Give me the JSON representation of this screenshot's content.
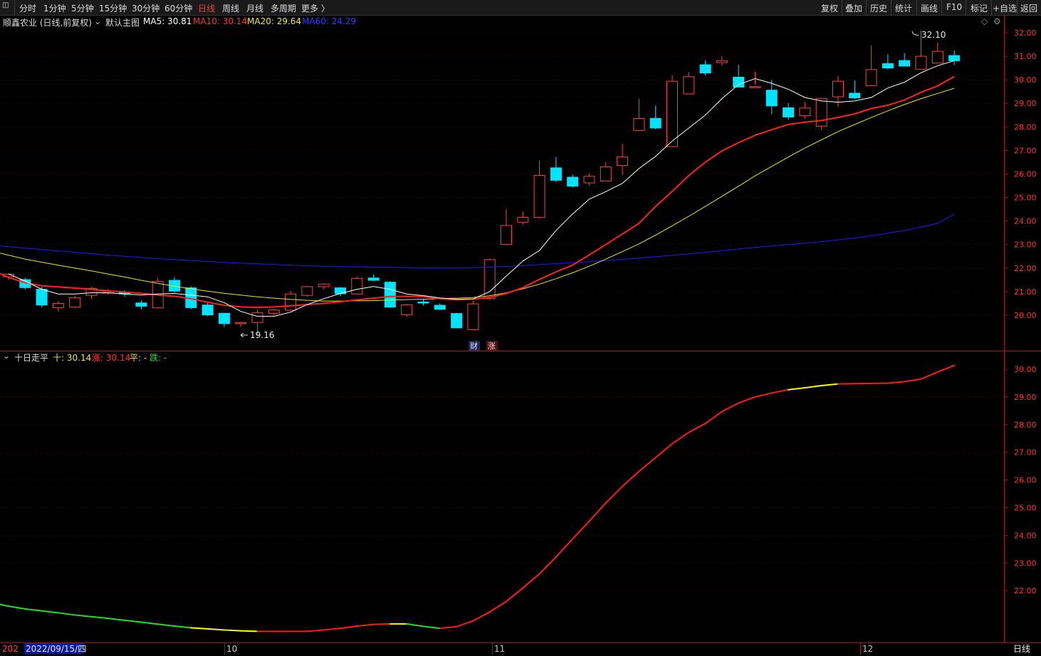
{
  "toolbar": {
    "periods": [
      "分时",
      "1分钟",
      "5分钟",
      "15分钟",
      "30分钟",
      "60分钟",
      "日线",
      "周线",
      "月线",
      "多周期",
      "更多 〉"
    ],
    "active_period": "日线",
    "right_items": [
      "复权",
      "叠加",
      "历史",
      "统计",
      "画线",
      "F10",
      "标记",
      "+自选",
      "返回"
    ]
  },
  "main": {
    "stock_label": "顺鑫农业 (日线,前复权)",
    "template_label": "默认主图",
    "ma5": "MA5: 30.81",
    "ma10": "MA10: 30.14",
    "ma20": "MA20: 29.64",
    "ma60": "MA60: 24.29",
    "high_label": "32.10",
    "low_label": "19.16",
    "tag_cai": "财",
    "tag_zhang": "涨",
    "price_ticks": [
      "32.00",
      "31.00",
      "30.00",
      "29.00",
      "28.00",
      "27.00",
      "26.00",
      "25.00",
      "24.00",
      "23.00",
      "22.00",
      "21.00",
      "20.00"
    ]
  },
  "indicator": {
    "name": "十日走平",
    "ten": "十: 30.14",
    "up": "涨: 30.14",
    "flat": "平: -",
    "down": "跌: -",
    "ticks": [
      "30.00",
      "29.00",
      "28.00",
      "27.00",
      "26.00",
      "25.00",
      "24.00",
      "23.00",
      "22.00"
    ]
  },
  "date_axis": {
    "year_prefix": "202",
    "cursor_date": "2022/09/15/四",
    "month_labels": [
      "10",
      "11",
      "12"
    ],
    "period": "日线"
  },
  "colors": {
    "up": "#ff4040",
    "down": "#00e5ff",
    "ma5": "#ffffff",
    "ma10": "#ff2020",
    "ma20": "#e8e800",
    "ma60": "#1a1aff",
    "ind_up": "#ff1a1a",
    "ind_flat": "#ffff00",
    "ind_down": "#20e020"
  },
  "chart_data": [
    {
      "type": "candlestick",
      "title": "顺鑫农业 (日线,前复权)",
      "ylim": [
        19.0,
        32.5
      ],
      "candles": [
        [
          21.63,
          21.74,
          21.5,
          21.78
        ],
        [
          21.51,
          21.17,
          21.1,
          21.59
        ],
        [
          21.1,
          20.43,
          20.34,
          21.2
        ],
        [
          20.32,
          20.5,
          20.15,
          20.61
        ],
        [
          20.34,
          20.74,
          20.3,
          20.83
        ],
        [
          20.84,
          21.13,
          20.7,
          21.2
        ],
        [
          20.94,
          21.0,
          20.88,
          21.12
        ],
        [
          20.96,
          20.9,
          20.78,
          21.05
        ],
        [
          20.52,
          20.38,
          20.25,
          20.63
        ],
        [
          20.31,
          21.43,
          20.28,
          21.58
        ],
        [
          21.48,
          21.02,
          20.95,
          21.62
        ],
        [
          21.16,
          20.32,
          20.26,
          21.22
        ],
        [
          20.43,
          20.01,
          19.97,
          20.54
        ],
        [
          20.08,
          19.64,
          19.5,
          20.1
        ],
        [
          19.67,
          19.68,
          19.5,
          19.71
        ],
        [
          19.69,
          20.1,
          19.16,
          20.24
        ],
        [
          20.08,
          20.22,
          20.0,
          20.26
        ],
        [
          20.21,
          20.9,
          20.17,
          21.03
        ],
        [
          20.84,
          21.21,
          20.79,
          21.25
        ],
        [
          21.21,
          21.32,
          21.1,
          21.36
        ],
        [
          21.16,
          20.91,
          20.8,
          21.2
        ],
        [
          20.9,
          21.56,
          20.86,
          21.65
        ],
        [
          21.58,
          21.48,
          21.45,
          21.73
        ],
        [
          21.4,
          20.34,
          20.32,
          21.45
        ],
        [
          20.02,
          20.44,
          19.93,
          20.48
        ],
        [
          20.56,
          20.52,
          20.42,
          20.66
        ],
        [
          20.42,
          20.25,
          20.21,
          20.5
        ],
        [
          20.07,
          19.46,
          19.45,
          20.1
        ],
        [
          19.38,
          20.48,
          19.36,
          20.6
        ],
        [
          20.7,
          22.36,
          20.65,
          22.4
        ],
        [
          23.0,
          23.81,
          22.97,
          24.5
        ],
        [
          23.95,
          24.16,
          23.85,
          24.4
        ],
        [
          24.15,
          25.94,
          24.1,
          26.58
        ],
        [
          26.26,
          25.73,
          25.65,
          26.72
        ],
        [
          25.86,
          25.48,
          25.42,
          25.97
        ],
        [
          25.62,
          25.9,
          25.5,
          26.03
        ],
        [
          25.7,
          26.3,
          25.7,
          26.5
        ],
        [
          26.36,
          26.72,
          25.95,
          27.28
        ],
        [
          27.84,
          28.36,
          27.83,
          29.2
        ],
        [
          28.36,
          27.95,
          27.9,
          28.9
        ],
        [
          27.16,
          29.94,
          27.16,
          30.2
        ],
        [
          29.4,
          30.13,
          29.4,
          30.33
        ],
        [
          30.64,
          30.29,
          30.18,
          30.82
        ],
        [
          30.73,
          30.81,
          30.6,
          31.01
        ],
        [
          30.11,
          29.69,
          29.9,
          30.64
        ],
        [
          29.71,
          29.71,
          29.8,
          30.34
        ],
        [
          29.56,
          28.89,
          28.55,
          30.0
        ],
        [
          28.81,
          28.42,
          28.3,
          29.01
        ],
        [
          28.48,
          28.8,
          28.35,
          29.05
        ],
        [
          28.03,
          29.21,
          27.86,
          29.15
        ],
        [
          29.28,
          29.94,
          28.85,
          30.16
        ],
        [
          29.43,
          29.23,
          29.18,
          29.97
        ],
        [
          29.75,
          30.43,
          29.9,
          31.45
        ],
        [
          30.69,
          30.5,
          30.45,
          31.08
        ],
        [
          30.82,
          30.58,
          30.59,
          31.13
        ],
        [
          30.45,
          31.0,
          30.46,
          32.1
        ],
        [
          30.71,
          31.21,
          30.85,
          31.58
        ],
        [
          31.03,
          30.81,
          30.63,
          31.25
        ]
      ],
      "ma5": [
        21.75,
        21.45,
        21.1,
        20.9,
        20.9,
        20.95,
        20.95,
        20.9,
        20.86,
        20.9,
        20.92,
        20.85,
        20.78,
        20.53,
        20.16,
        19.95,
        19.95,
        20.13,
        20.45,
        20.7,
        20.92,
        21.1,
        21.22,
        21.1,
        20.9,
        20.83,
        20.73,
        20.68,
        20.69,
        21.0,
        21.66,
        22.3,
        22.75,
        23.6,
        24.3,
        24.93,
        25.25,
        25.6,
        26.23,
        26.75,
        27.4,
        27.95,
        28.5,
        29.2,
        29.8,
        30.05,
        29.85,
        29.6,
        29.25,
        29.1,
        29.05,
        29.1,
        29.25,
        29.65,
        29.9,
        30.3,
        30.6,
        30.81
      ],
      "ma10": [
        22.2,
        21.92,
        21.6,
        21.38,
        21.25,
        21.2,
        21.15,
        21.1,
        21.03,
        20.98,
        20.93,
        20.85,
        20.8,
        20.7,
        20.55,
        20.42,
        20.35,
        20.33,
        20.35,
        20.4,
        20.45,
        20.5,
        20.57,
        20.65,
        20.72,
        20.79,
        20.8,
        20.79,
        20.7,
        20.65,
        20.68,
        20.75,
        20.92,
        21.17,
        21.52,
        21.84,
        22.13,
        22.56,
        23.0,
        23.45,
        23.9,
        24.62,
        25.26,
        25.93,
        26.5,
        26.98,
        27.33,
        27.64,
        27.88,
        28.1,
        28.2,
        28.27,
        28.4,
        28.55,
        28.78,
        28.92,
        29.14,
        29.47,
        29.74,
        30.14
      ],
      "ma20": [
        22.9,
        22.72,
        22.55,
        22.38,
        22.25,
        22.12,
        22.0,
        21.88,
        21.75,
        21.62,
        21.48,
        21.35,
        21.23,
        21.12,
        21.02,
        20.93,
        20.85,
        20.78,
        20.72,
        20.67,
        20.63,
        20.6,
        20.6,
        20.61,
        20.62,
        20.64,
        20.66,
        20.68,
        20.7,
        20.72,
        20.75,
        20.82,
        20.95,
        21.12,
        21.32,
        21.55,
        21.8,
        22.08,
        22.38,
        22.7,
        23.03,
        23.4,
        23.8,
        24.2,
        24.62,
        25.05,
        25.48,
        25.92,
        26.32,
        26.72,
        27.1,
        27.45,
        27.8,
        28.1,
        28.4,
        28.68,
        28.95,
        29.2,
        29.42,
        29.64
      ],
      "ma60": [
        23.02,
        22.97,
        22.91,
        22.85,
        22.79,
        22.73,
        22.67,
        22.61,
        22.55,
        22.5,
        22.45,
        22.4,
        22.36,
        22.32,
        22.28,
        22.24,
        22.21,
        22.18,
        22.15,
        22.12,
        22.1,
        22.08,
        22.06,
        22.05,
        22.04,
        22.03,
        22.02,
        22.01,
        22.01,
        22.01,
        22.02,
        22.04,
        22.07,
        22.11,
        22.15,
        22.19,
        22.23,
        22.27,
        22.32,
        22.37,
        22.43,
        22.48,
        22.54,
        22.6,
        22.67,
        22.74,
        22.81,
        22.88,
        22.94,
        23.0,
        23.06,
        23.12,
        23.2,
        23.28,
        23.37,
        23.48,
        23.6,
        23.74,
        23.9,
        24.29
      ]
    },
    {
      "type": "line",
      "title": "十日走平",
      "ylim": [
        21.0,
        30.4
      ],
      "series": [
        {
          "name": "十",
          "values": [
            22.2,
            21.96,
            21.72,
            21.56,
            21.44,
            21.34,
            21.27,
            21.2,
            21.12,
            21.06,
            21.0,
            20.93,
            20.86,
            20.79,
            20.72,
            20.66,
            20.62,
            20.58,
            20.55,
            20.53,
            20.53,
            20.53,
            20.53,
            20.58,
            20.64,
            20.72,
            20.78,
            20.8,
            20.8,
            20.71,
            20.64,
            20.7,
            20.91,
            21.23,
            21.61,
            22.1,
            22.61,
            23.22,
            23.87,
            24.51,
            25.17,
            25.77,
            26.31,
            26.81,
            27.31,
            27.72,
            28.04,
            28.47,
            28.78,
            29.0,
            29.14,
            29.26,
            29.33,
            29.41,
            29.47,
            29.48,
            29.49,
            29.5,
            29.55,
            29.65,
            29.9,
            30.14
          ]
        }
      ],
      "state": [
        "down",
        "down",
        "down",
        "down",
        "down",
        "down",
        "down",
        "down",
        "down",
        "down",
        "down",
        "down",
        "down",
        "down",
        "down",
        "down",
        "flat",
        "flat",
        "flat",
        "flat",
        "up",
        "up",
        "up",
        "up",
        "up",
        "up",
        "up",
        "up",
        "flat",
        "down",
        "down",
        "up",
        "up",
        "up",
        "up",
        "up",
        "up",
        "up",
        "up",
        "up",
        "up",
        "up",
        "up",
        "up",
        "up",
        "up",
        "up",
        "up",
        "up",
        "up",
        "up",
        "up",
        "flat",
        "flat",
        "flat",
        "up",
        "up",
        "up",
        "up",
        "up",
        "up",
        "up"
      ]
    }
  ]
}
